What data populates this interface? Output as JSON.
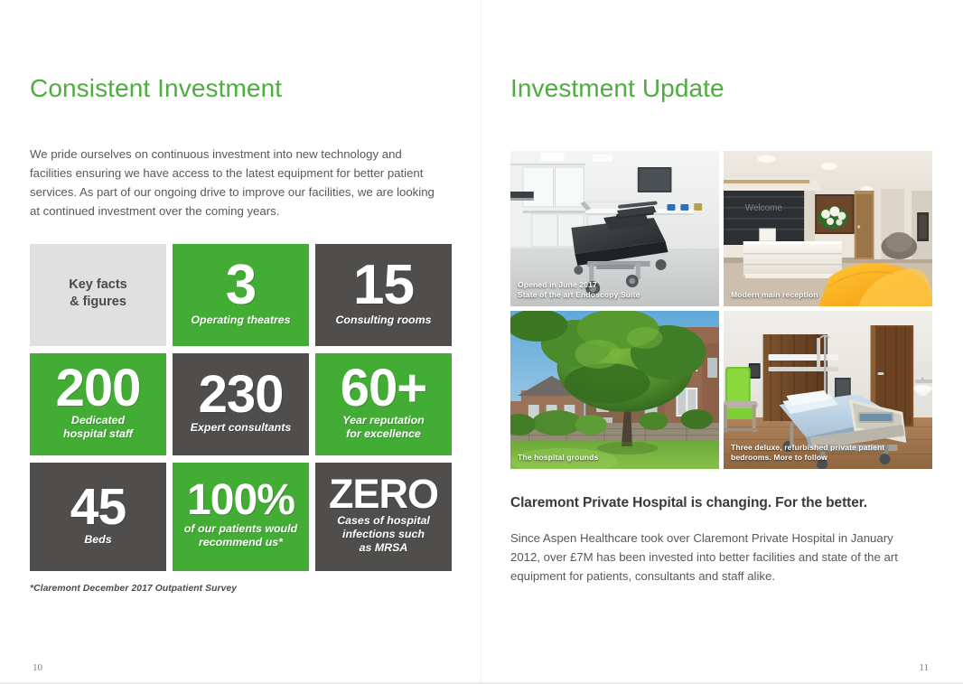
{
  "left_page": {
    "heading": "Consistent Investment",
    "intro": "We pride ourselves on continuous investment into new technology and facilities ensuring we have access to the latest equipment for better patient services. As part of our ongoing drive to improve our facilities, we are looking at continued investment over the coming years.",
    "footnote": "*Claremont December 2017 Outpatient Survey",
    "page_number": "10",
    "stats": [
      {
        "number": "",
        "label": "Key facts\n& figures",
        "style": "light"
      },
      {
        "number": "3",
        "label": "Operating theatres",
        "style": "green"
      },
      {
        "number": "15",
        "label": "Consulting rooms",
        "style": "dark"
      },
      {
        "number": "200",
        "label": "Dedicated\nhospital staff",
        "style": "green"
      },
      {
        "number": "230",
        "label": "Expert consultants",
        "style": "dark"
      },
      {
        "number": "60+",
        "label": "Year reputation\nfor excellence",
        "style": "green"
      },
      {
        "number": "45",
        "label": "Beds",
        "style": "dark"
      },
      {
        "number": "100%",
        "label": "of our patients would\nrecommend us*",
        "style": "green"
      },
      {
        "number": "ZERO",
        "label": "Cases of hospital\ninfections such\nas MRSA",
        "style": "dark"
      }
    ]
  },
  "right_page": {
    "heading": "Investment Update",
    "photos": [
      {
        "caption": "Opened in June 2017\nState of the art Endoscopy Suite",
        "alt": "endoscopy-suite-photo"
      },
      {
        "caption": "Modern main reception",
        "alt": "main-reception-photo"
      },
      {
        "caption": "The hospital grounds",
        "alt": "hospital-grounds-photo"
      },
      {
        "caption": "Three deluxe, refurbished private patient\nbedrooms. More to follow",
        "alt": "private-patient-bedroom-photo"
      }
    ],
    "subhead": "Claremont Private Hospital is changing. For the better.",
    "body": "Since Aspen Healthcare took over Claremont Private Hospital in January 2012, over £7M has been invested into better facilities and state of the art equipment for patients, consultants and staff alike.",
    "page_number": "11"
  },
  "colors": {
    "brand_green": "#43ac34",
    "heading_green": "#4caf3d",
    "dark_gray": "#4f4e4c",
    "light_gray": "#e0e0e0",
    "body_text": "#58585a"
  }
}
